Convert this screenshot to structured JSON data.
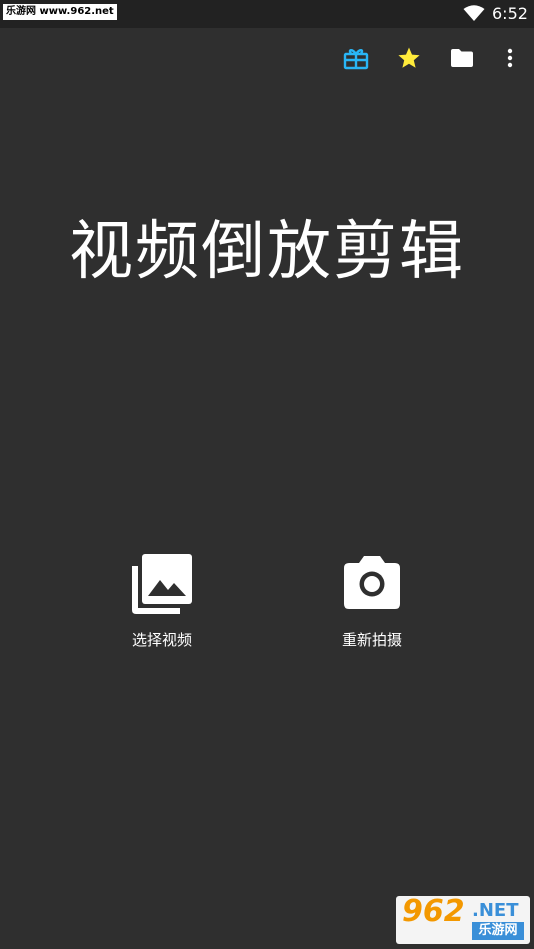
{
  "status_bar": {
    "watermark": "乐游网 www.962.net",
    "time": "6:52",
    "wifi_icon": "wifi-icon"
  },
  "toolbar": {
    "icons": [
      "gift-icon",
      "star-icon",
      "folder-icon",
      "more-vert-icon"
    ],
    "gift_color": "#29b6f6",
    "star_color": "#ffeb3b"
  },
  "main": {
    "title": "视频倒放剪辑"
  },
  "actions": {
    "select_video": {
      "label": "选择视频",
      "icon": "photo-library-icon"
    },
    "record": {
      "label": "重新拍摄",
      "icon": "camera-icon"
    }
  },
  "watermark_logo": {
    "number": "962",
    "net": ".NET",
    "name": "乐游网"
  },
  "colors": {
    "background": "#2f2f2f",
    "status_bar": "#222222",
    "text": "#ffffff"
  }
}
